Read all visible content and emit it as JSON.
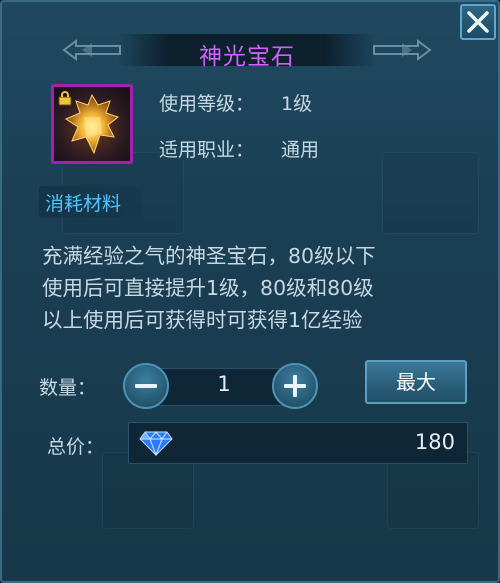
{
  "dialog": {
    "title": "神光宝石",
    "close_label": "X"
  },
  "item": {
    "icon": "golden-gem-icon",
    "locked": true,
    "frame_color": "#a620b0"
  },
  "info": {
    "level_label": "使用等级：",
    "level_value": "1级",
    "class_label": "适用职业：",
    "class_value": "通用"
  },
  "tag": {
    "label": "消耗材料",
    "color": "#4fc4ff"
  },
  "description": {
    "lines": [
      "充满经验之气的神圣宝石，80级以下",
      "使用后可直接提升1级，80级和80级",
      "以上使用后可获得时可获得1亿经验"
    ]
  },
  "quantity": {
    "label": "数量：",
    "value": "1",
    "minus_icon": "minus-icon",
    "plus_icon": "plus-icon",
    "max_label": "最大"
  },
  "total": {
    "label": "总价：",
    "currency_icon": "diamond-icon",
    "value": "180"
  },
  "colors": {
    "title": "#d061ff",
    "text": "#c8d8e2",
    "panel": "#1f4960"
  }
}
